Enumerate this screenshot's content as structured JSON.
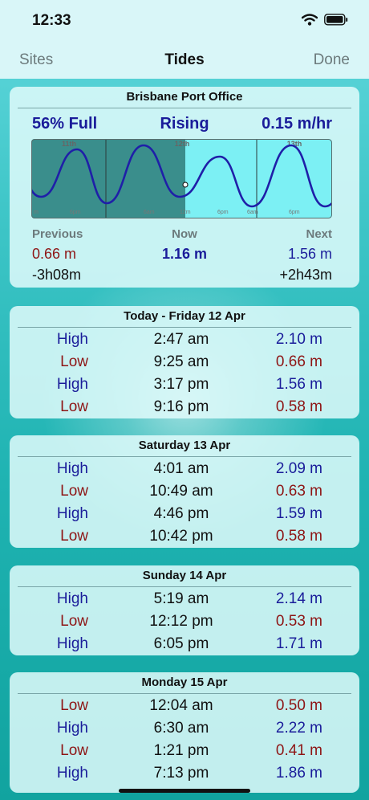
{
  "status": {
    "time": "12:33"
  },
  "nav": {
    "left": "Sites",
    "title": "Tides",
    "right": "Done"
  },
  "summary": {
    "station": "Brisbane Port Office",
    "fill": "56% Full",
    "trend": "Rising",
    "rate": "0.15 m/hr",
    "labels": {
      "previous": "Previous",
      "now": "Now",
      "next": "Next"
    },
    "previous_height": "0.66 m",
    "previous_offset": "-3h08m",
    "now_height": "1.16 m",
    "next_height": "1.56 m",
    "next_offset": "+2h43m"
  },
  "chart_data": {
    "type": "line",
    "day_labels": [
      "11th",
      "12th",
      "13th"
    ],
    "tick_labels": [
      "m",
      "6pm",
      "6am",
      "12m",
      "6pm",
      "6am",
      "6pm"
    ],
    "now_marker": "12m",
    "curve_color": "#1f1fa8",
    "past_shade": "#3a8e8c",
    "future_fill": "#7cf0f4"
  },
  "days": [
    {
      "title": "Today - Friday 12 Apr",
      "tides": [
        {
          "kind": "High",
          "time": "2:47 am",
          "height": "2.10 m"
        },
        {
          "kind": "Low",
          "time": "9:25 am",
          "height": "0.66 m"
        },
        {
          "kind": "High",
          "time": "3:17 pm",
          "height": "1.56 m"
        },
        {
          "kind": "Low",
          "time": "9:16 pm",
          "height": "0.58 m"
        }
      ]
    },
    {
      "title": "Saturday 13 Apr",
      "tides": [
        {
          "kind": "High",
          "time": "4:01 am",
          "height": "2.09 m"
        },
        {
          "kind": "Low",
          "time": "10:49 am",
          "height": "0.63 m"
        },
        {
          "kind": "High",
          "time": "4:46 pm",
          "height": "1.59 m"
        },
        {
          "kind": "Low",
          "time": "10:42 pm",
          "height": "0.58 m"
        }
      ]
    },
    {
      "title": "Sunday 14 Apr",
      "tides": [
        {
          "kind": "High",
          "time": "5:19 am",
          "height": "2.14 m"
        },
        {
          "kind": "Low",
          "time": "12:12 pm",
          "height": "0.53 m"
        },
        {
          "kind": "High",
          "time": "6:05 pm",
          "height": "1.71 m"
        }
      ]
    },
    {
      "title": "Monday 15 Apr",
      "tides": [
        {
          "kind": "Low",
          "time": "12:04 am",
          "height": "0.50 m"
        },
        {
          "kind": "High",
          "time": "6:30 am",
          "height": "2.22 m"
        },
        {
          "kind": "Low",
          "time": "1:21 pm",
          "height": "0.41 m"
        },
        {
          "kind": "High",
          "time": "7:13 pm",
          "height": "1.86 m"
        }
      ]
    }
  ]
}
